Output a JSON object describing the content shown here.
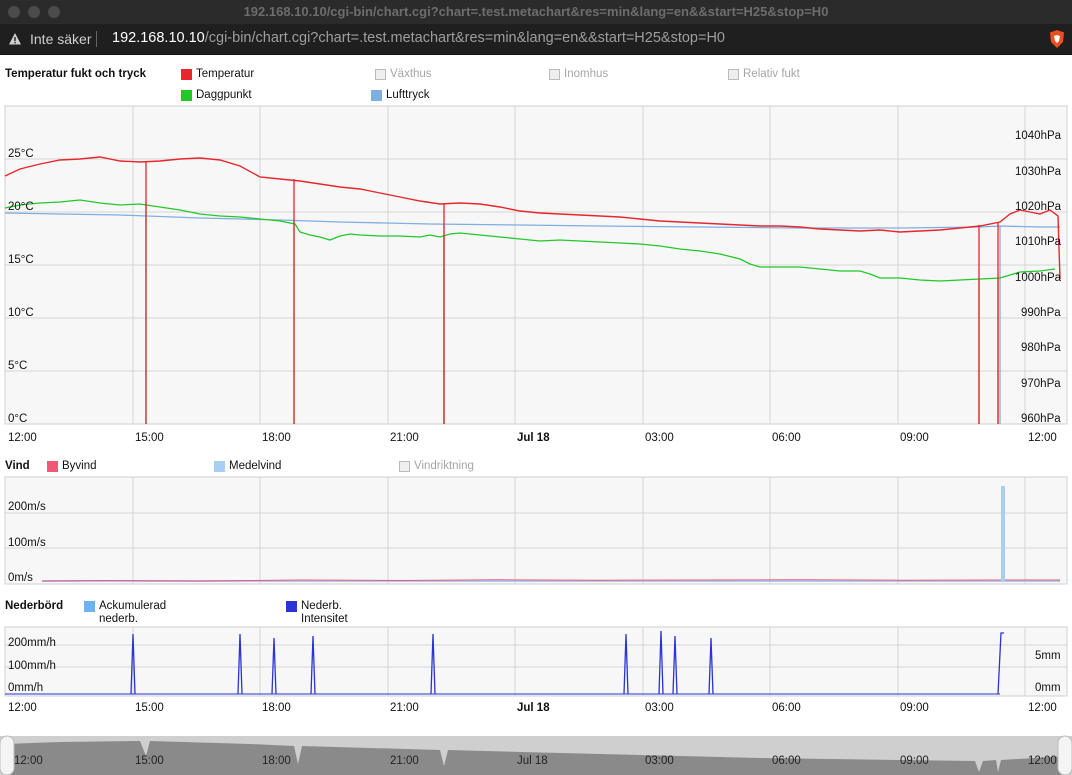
{
  "browser": {
    "window_title": "192.168.10.10/cgi-bin/chart.cgi?chart=.test.metachart&res=min&lang=en&&start=H25&stop=H0",
    "security_label": "Inte säker",
    "url_host": "192.168.10.10",
    "url_path": "/cgi-bin/chart.cgi?chart=.test.metachart&res=min&lang=en&&start=H25&stop=H0",
    "toolbar_icons": [
      "warning-icon",
      "brave-shield-icon"
    ]
  },
  "x_axis_labels": [
    "12:00",
    "15:00",
    "18:00",
    "21:00",
    "Jul 18",
    "03:00",
    "06:00",
    "09:00",
    "12:00"
  ],
  "navigator_labels": [
    "12:00",
    "15:00",
    "18:00",
    "21:00",
    "Jul 18",
    "03:00",
    "06:00",
    "09:00",
    "12:00"
  ],
  "colors": {
    "temperature": "#e8262d",
    "dewpoint": "#21c82a",
    "pressure": "#7faee0",
    "gust": "#f05876",
    "avg_wind": "#a7cef3",
    "acc_rain": "#6eb2f0",
    "rain_intensity": "#2a33d6",
    "disabled": "#a6a6a6"
  },
  "panel1": {
    "title": "Temperatur fukt och tryck",
    "legend": [
      {
        "label": "Temperatur",
        "enabled": true
      },
      {
        "label": "Växthus",
        "enabled": false
      },
      {
        "label": "Inomhus",
        "enabled": false
      },
      {
        "label": "Relativ fukt",
        "enabled": false
      },
      {
        "label": "Daggpunkt",
        "enabled": true
      },
      {
        "label": "Lufttryck",
        "enabled": true
      }
    ],
    "left_axis": [
      "25°C",
      "20°C",
      "15°C",
      "10°C",
      "5°C",
      "0°C"
    ],
    "right_axis": [
      "1040hPa",
      "1030hPa",
      "1020hPa",
      "1010hPa",
      "1000hPa",
      "990hPa",
      "980hPa",
      "970hPa",
      "960hPa"
    ]
  },
  "panel2": {
    "title": "Vind",
    "legend": [
      {
        "label": "Byvind",
        "enabled": true
      },
      {
        "label": "Medelvind",
        "enabled": true
      },
      {
        "label": "Vindriktning",
        "enabled": false
      }
    ],
    "left_axis": [
      "200m/s",
      "100m/s",
      "0m/s"
    ]
  },
  "panel3": {
    "title": "Nederbörd",
    "legend": [
      {
        "label1": "Ackumulerad",
        "label2": "nederb."
      },
      {
        "label1": "Nederb.",
        "label2": "Intensitet"
      }
    ],
    "left_axis": [
      "200mm/h",
      "100mm/h",
      "0mm/h"
    ],
    "right_axis": [
      "5mm",
      "0mm"
    ]
  },
  "chart_data": [
    {
      "type": "line",
      "title": "Temperatur fukt och tryck",
      "x_range": [
        "12:00",
        "Jul 18 12:00"
      ],
      "y_left_unit": "°C",
      "y_left_range": [
        0,
        26
      ],
      "y_right_unit": "hPa",
      "y_right_range": [
        960,
        1045
      ],
      "series": [
        {
          "name": "Temperatur",
          "axis": "left",
          "points": [
            [
              0,
              23.8
            ],
            [
              1,
              24.6
            ],
            [
              2,
              24.3
            ],
            [
              3,
              24.1
            ],
            [
              4,
              23.8
            ],
            [
              5,
              23.2
            ],
            [
              6,
              22.5
            ],
            [
              7,
              22
            ],
            [
              8,
              21
            ],
            [
              9,
              20.7
            ],
            [
              10,
              20.4
            ],
            [
              11,
              19.7
            ],
            [
              12,
              19.3
            ],
            [
              13,
              19
            ],
            [
              14,
              18.7
            ],
            [
              15,
              18.4
            ],
            [
              16,
              18.1
            ],
            [
              17,
              17.9
            ],
            [
              18,
              17.9
            ],
            [
              19,
              17.6
            ],
            [
              20,
              17.3
            ],
            [
              21,
              17.2
            ],
            [
              22,
              17.2
            ],
            [
              23,
              17.3
            ],
            [
              23.5,
              19.8
            ],
            [
              24,
              19.1
            ],
            [
              24.5,
              15.5
            ]
          ],
          "drops_to_zero_at": [
            3.3,
            9.1,
            15.0,
            23.1,
            23.7
          ]
        },
        {
          "name": "Daggpunkt",
          "axis": "left",
          "points": [
            [
              0,
              19.6
            ],
            [
              1,
              20
            ],
            [
              2,
              20.4
            ],
            [
              3,
              20
            ],
            [
              4,
              19.4
            ],
            [
              5,
              19.3
            ],
            [
              6,
              19
            ],
            [
              7,
              17.5
            ],
            [
              8,
              17
            ],
            [
              9,
              17.2
            ],
            [
              10,
              17.7
            ],
            [
              11,
              17
            ],
            [
              12,
              16.8
            ],
            [
              13,
              16.5
            ],
            [
              14,
              16.2
            ],
            [
              15,
              15.8
            ],
            [
              16,
              15.2
            ],
            [
              17,
              14.7
            ],
            [
              18,
              14.8
            ],
            [
              19,
              14.4
            ],
            [
              20,
              13.7
            ],
            [
              21,
              13.6
            ],
            [
              22,
              13.3
            ],
            [
              23,
              13.6
            ],
            [
              24,
              14.2
            ],
            [
              24.4,
              14.5
            ]
          ],
          "drops_to_zero_at": [
            3.3,
            9.1,
            15.0,
            23.1,
            23.7
          ]
        },
        {
          "name": "Lufttryck",
          "axis": "right",
          "points": [
            [
              0,
              1017
            ],
            [
              3,
              1016.5
            ],
            [
              6,
              1015
            ],
            [
              9,
              1014
            ],
            [
              12,
              1013.5
            ],
            [
              15,
              1013
            ],
            [
              18,
              1012.5
            ],
            [
              21,
              1012
            ],
            [
              24,
              1012.5
            ],
            [
              24.5,
              1012
            ]
          ],
          "drops_to_min_at": [
            9.1,
            23.7
          ]
        }
      ]
    },
    {
      "type": "bar",
      "title": "Vind",
      "y_unit": "m/s",
      "y_range": [
        0,
        280
      ],
      "series": [
        {
          "name": "Byvind",
          "values": "≈2–3 m/s throughout"
        },
        {
          "name": "Medelvind",
          "values": "≈1–2 m/s; spike ≈270 m/s at ~10:50"
        }
      ]
    },
    {
      "type": "bar",
      "title": "Nederbörd",
      "y_unit": "mm/h",
      "y_range": [
        0,
        250
      ],
      "series": [
        {
          "name": "Ackumulerad nederb.",
          "values": "0"
        },
        {
          "name": "Nederb. Intensitet",
          "spikes_at_hours": [
            3.0,
            5.5,
            6.3,
            7.2,
            10.0,
            14.7,
            15.5,
            15.8,
            16.7,
            23.8
          ],
          "spike_value": 230
        }
      ]
    }
  ]
}
